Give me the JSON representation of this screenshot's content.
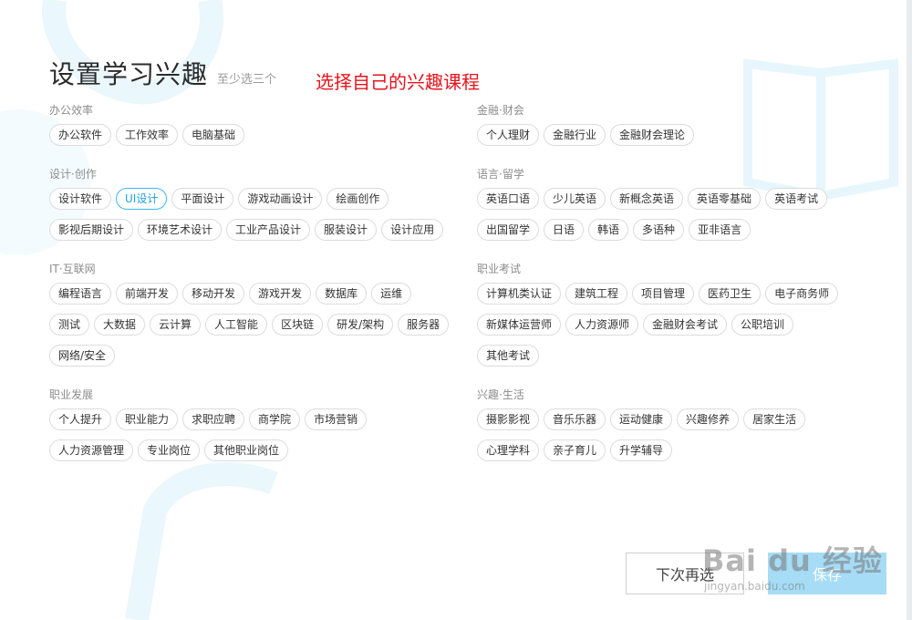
{
  "header": {
    "title": "设置学习兴趣",
    "subtitle": "至少选三个",
    "annotation": "选择自己的兴趣课程"
  },
  "left_sections": [
    {
      "title": "办公效率",
      "tags": [
        "办公软件",
        "工作效率",
        "电脑基础"
      ]
    },
    {
      "title": "设计·创作",
      "tags": [
        "设计软件",
        "UI设计",
        "平面设计",
        "游戏动画设计",
        "绘画创作",
        "影视后期设计",
        "环境艺术设计",
        "工业产品设计",
        "服装设计",
        "设计应用"
      ]
    },
    {
      "title": "IT·互联网",
      "tags": [
        "编程语言",
        "前端开发",
        "移动开发",
        "游戏开发",
        "数据库",
        "运维",
        "测试",
        "大数据",
        "云计算",
        "人工智能",
        "区块链",
        "研发/架构",
        "服务器",
        "网络/安全"
      ]
    },
    {
      "title": "职业发展",
      "tags": [
        "个人提升",
        "职业能力",
        "求职应聘",
        "商学院",
        "市场营销",
        "人力资源管理",
        "专业岗位",
        "其他职业岗位"
      ]
    }
  ],
  "right_sections": [
    {
      "title": "金融·财会",
      "tags": [
        "个人理财",
        "金融行业",
        "金融财会理论"
      ]
    },
    {
      "title": "语言·留学",
      "tags": [
        "英语口语",
        "少儿英语",
        "新概念英语",
        "英语零基础",
        "英语考试",
        "出国留学",
        "日语",
        "韩语",
        "多语种",
        "亚非语言"
      ]
    },
    {
      "title": "职业考试",
      "tags": [
        "计算机类认证",
        "建筑工程",
        "项目管理",
        "医药卫生",
        "电子商务师",
        "新媒体运营师",
        "人力资源师",
        "金融财会考试",
        "公职培训",
        "其他考试"
      ]
    },
    {
      "title": "兴趣·生活",
      "tags": [
        "摄影影视",
        "音乐乐器",
        "运动健康",
        "兴趣修养",
        "居家生活",
        "心理学科",
        "亲子育儿",
        "升学辅导"
      ]
    }
  ],
  "selected_tag": "UI设计",
  "buttons": {
    "next": "下次再选",
    "save": "保存"
  },
  "watermark": {
    "brand": "Bai du 经验",
    "url": "jingyan.baidu.com"
  },
  "colors": {
    "selected": "#3cb9f0",
    "annotation": "#e8141d",
    "save_bg": "#a6dcf5"
  }
}
